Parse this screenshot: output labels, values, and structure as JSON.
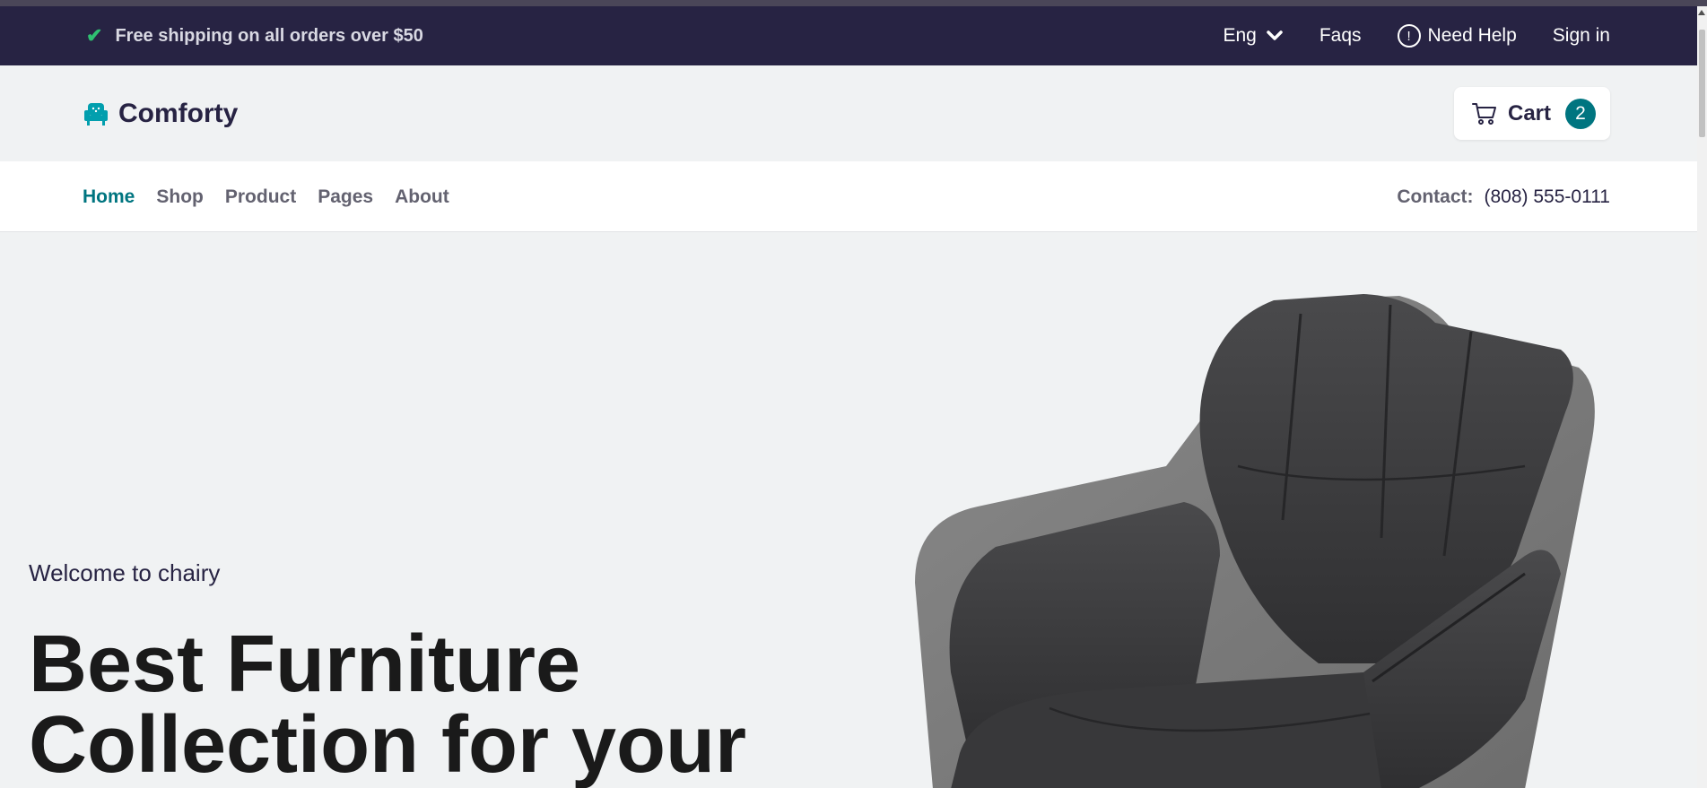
{
  "topbar": {
    "shipping_text": "Free shipping on all orders over $50",
    "language": "Eng",
    "faqs": "Faqs",
    "need_help": "Need Help",
    "sign_in": "Sign in"
  },
  "header": {
    "brand": "Comforty",
    "cart_label": "Cart",
    "cart_count": "2"
  },
  "nav": {
    "items": [
      {
        "label": "Home",
        "active": true
      },
      {
        "label": "Shop",
        "active": false
      },
      {
        "label": "Product",
        "active": false
      },
      {
        "label": "Pages",
        "active": false
      },
      {
        "label": "About",
        "active": false
      }
    ],
    "contact_label": "Contact:",
    "contact_phone": "(808) 555-0111"
  },
  "hero": {
    "welcome": "Welcome to chairy",
    "title_line1": "Best Furniture",
    "title_line2": "Collection for your"
  },
  "colors": {
    "topbar_bg": "#272343",
    "accent": "#007580",
    "check": "#2fbf71",
    "page_bg": "#f0f2f3"
  },
  "icons": {
    "check": "check-icon",
    "chevron": "chevron-down-icon",
    "help": "info-circle-icon",
    "logo": "armchair-logo-icon",
    "cart": "cart-icon"
  }
}
